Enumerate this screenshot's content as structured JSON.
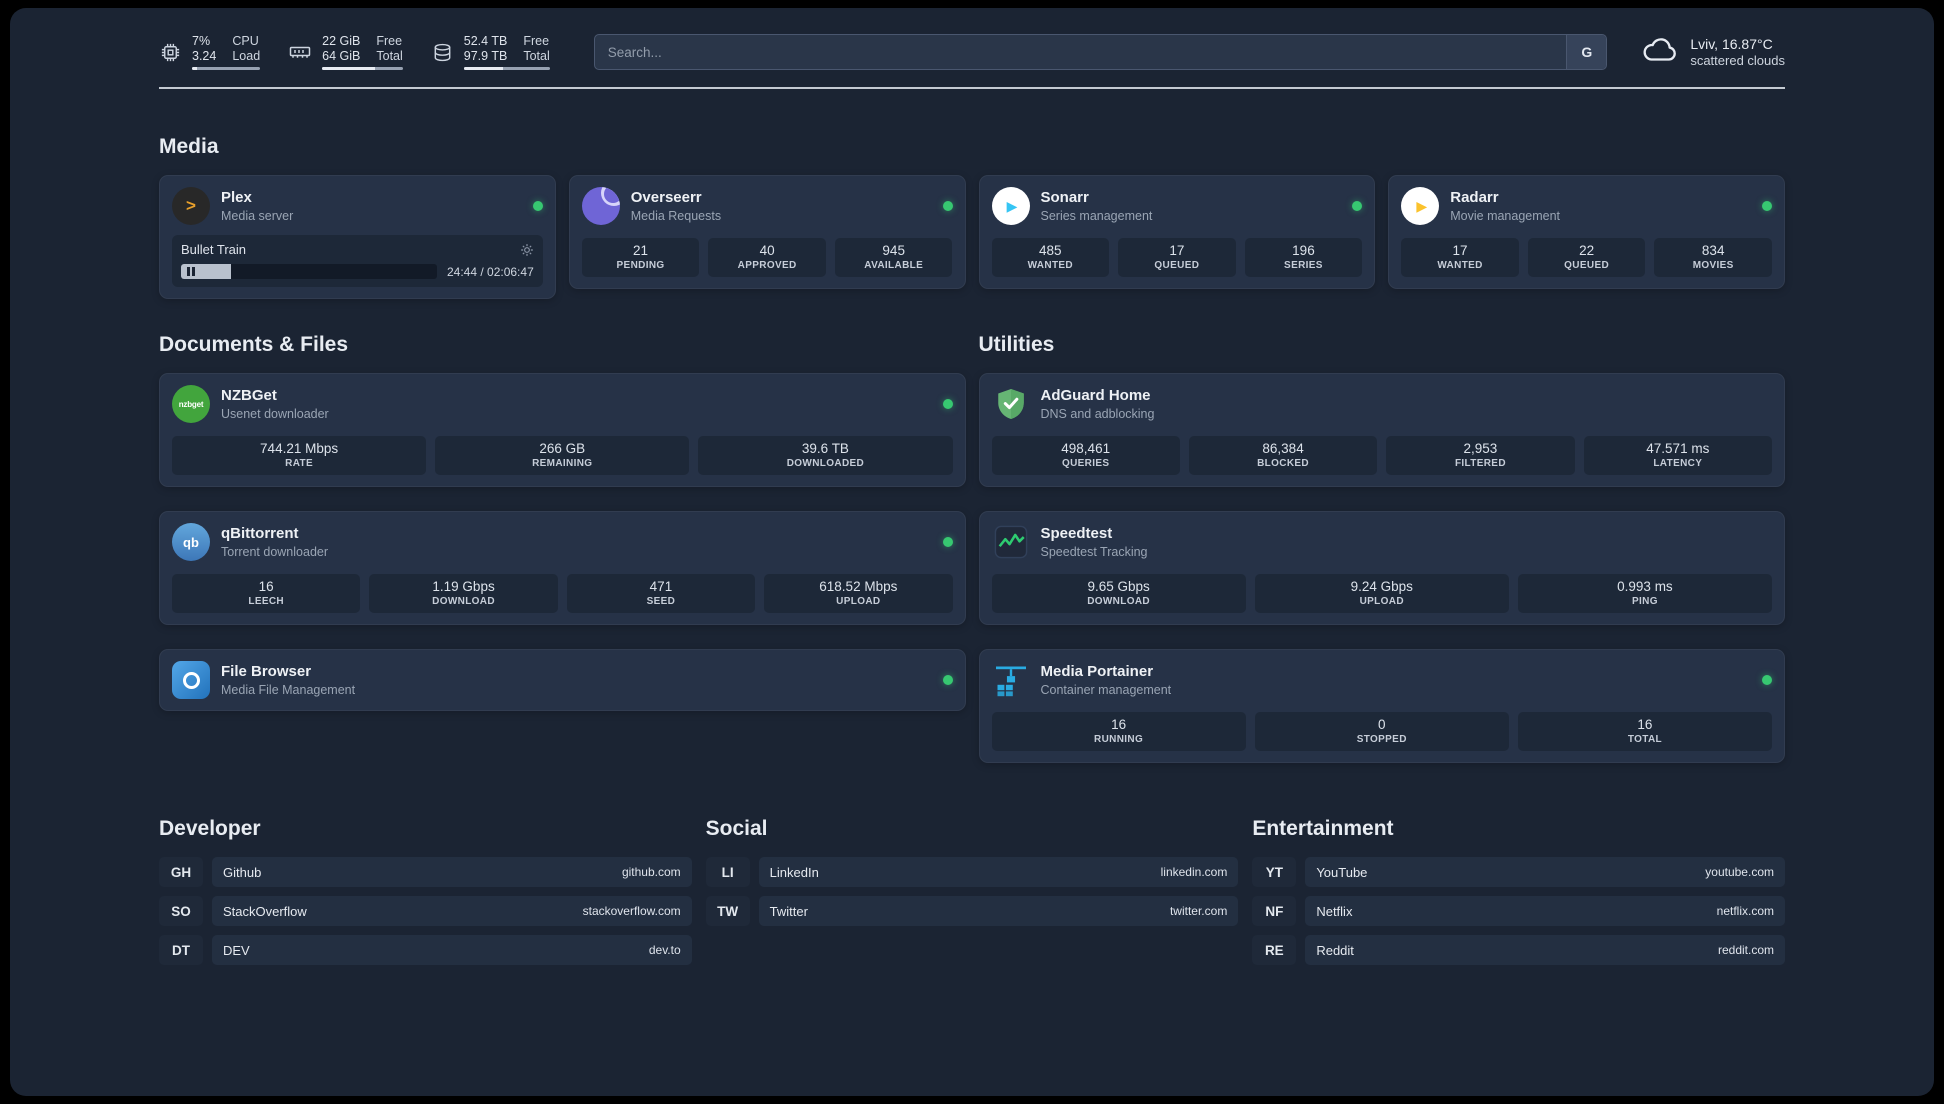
{
  "topbar": {
    "metrics": [
      {
        "value_top": "7%",
        "label_top": "CPU",
        "value_bottom": "3.24",
        "label_bottom": "Load",
        "progress_pct": 7
      },
      {
        "value_top": "22 GiB",
        "label_top": "Free",
        "value_bottom": "64 GiB",
        "label_bottom": "Total",
        "progress_pct": 66
      },
      {
        "value_top": "52.4 TB",
        "label_top": "Free",
        "value_bottom": "97.9 TB",
        "label_bottom": "Total",
        "progress_pct": 46
      }
    ],
    "search": {
      "placeholder": "Search...",
      "engine_button": "G"
    },
    "weather": {
      "location": "Lviv, 16.87°C",
      "condition": "scattered clouds"
    }
  },
  "sections": {
    "media": "Media",
    "documents": "Documents & Files",
    "utilities": "Utilities",
    "developer": "Developer",
    "social": "Social",
    "entertainment": "Entertainment"
  },
  "apps": {
    "plex": {
      "name": "Plex",
      "desc": "Media server",
      "online": true,
      "player": {
        "track": "Bullet Train",
        "time": "24:44 / 02:06:47",
        "progress_pct": 19.5
      }
    },
    "overseerr": {
      "name": "Overseerr",
      "desc": "Media Requests",
      "online": true,
      "stats": [
        {
          "value": "21",
          "label": "PENDING"
        },
        {
          "value": "40",
          "label": "APPROVED"
        },
        {
          "value": "945",
          "label": "AVAILABLE"
        }
      ]
    },
    "sonarr": {
      "name": "Sonarr",
      "desc": "Series management",
      "online": true,
      "stats": [
        {
          "value": "485",
          "label": "WANTED"
        },
        {
          "value": "17",
          "label": "QUEUED"
        },
        {
          "value": "196",
          "label": "SERIES"
        }
      ]
    },
    "radarr": {
      "name": "Radarr",
      "desc": "Movie management",
      "online": true,
      "stats": [
        {
          "value": "17",
          "label": "WANTED"
        },
        {
          "value": "22",
          "label": "QUEUED"
        },
        {
          "value": "834",
          "label": "MOVIES"
        }
      ]
    },
    "nzbget": {
      "name": "NZBGet",
      "desc": "Usenet downloader",
      "online": true,
      "stats": [
        {
          "value": "744.21 Mbps",
          "label": "RATE"
        },
        {
          "value": "266 GB",
          "label": "REMAINING"
        },
        {
          "value": "39.6 TB",
          "label": "DOWNLOADED"
        }
      ]
    },
    "qbittorrent": {
      "name": "qBittorrent",
      "desc": "Torrent downloader",
      "online": true,
      "stats": [
        {
          "value": "16",
          "label": "LEECH"
        },
        {
          "value": "1.19 Gbps",
          "label": "DOWNLOAD"
        },
        {
          "value": "471",
          "label": "SEED"
        },
        {
          "value": "618.52 Mbps",
          "label": "UPLOAD"
        }
      ]
    },
    "filebrowser": {
      "name": "File Browser",
      "desc": "Media File Management",
      "online": true
    },
    "adguard": {
      "name": "AdGuard Home",
      "desc": "DNS and adblocking",
      "online": false,
      "stats": [
        {
          "value": "498,461",
          "label": "QUERIES"
        },
        {
          "value": "86,384",
          "label": "BLOCKED"
        },
        {
          "value": "2,953",
          "label": "FILTERED"
        },
        {
          "value": "47.571 ms",
          "label": "LATENCY"
        }
      ]
    },
    "speedtest": {
      "name": "Speedtest",
      "desc": "Speedtest Tracking",
      "online": false,
      "stats": [
        {
          "value": "9.65 Gbps",
          "label": "DOWNLOAD"
        },
        {
          "value": "9.24 Gbps",
          "label": "UPLOAD"
        },
        {
          "value": "0.993 ms",
          "label": "PING"
        }
      ]
    },
    "portainer": {
      "name": "Media Portainer",
      "desc": "Container management",
      "online": true,
      "stats": [
        {
          "value": "16",
          "label": "RUNNING"
        },
        {
          "value": "0",
          "label": "STOPPED"
        },
        {
          "value": "16",
          "label": "TOTAL"
        }
      ]
    }
  },
  "icons": {
    "plex_glyph": ">",
    "sonarr_glyph": "▶",
    "radarr_glyph": "▶",
    "qbittorrent_glyph": "qb",
    "nzbget_glyph": "nzbget"
  },
  "bookmarks": {
    "developer": [
      {
        "abbr": "GH",
        "name": "Github",
        "url": "github.com"
      },
      {
        "abbr": "SO",
        "name": "StackOverflow",
        "url": "stackoverflow.com"
      },
      {
        "abbr": "DT",
        "name": "DEV",
        "url": "dev.to"
      }
    ],
    "social": [
      {
        "abbr": "LI",
        "name": "LinkedIn",
        "url": "linkedin.com"
      },
      {
        "abbr": "TW",
        "name": "Twitter",
        "url": "twitter.com"
      }
    ],
    "entertainment": [
      {
        "abbr": "YT",
        "name": "YouTube",
        "url": "youtube.com"
      },
      {
        "abbr": "NF",
        "name": "Netflix",
        "url": "netflix.com"
      },
      {
        "abbr": "RE",
        "name": "Reddit",
        "url": "reddit.com"
      }
    ]
  },
  "colors": {
    "background": "#1B2433",
    "card": "#263247",
    "tile": "#1D2838",
    "status_online": "#37C871",
    "plex_accent": "#e8a02b",
    "overseerr_purple": "#6f65d6",
    "sonarr_blue": "#35c5f4",
    "radarr_yellow": "#fbc22c",
    "nzbget_green": "#42a53d",
    "qbittorrent_blue": "#3d77b8",
    "filebrowser_blue": "#2272bb",
    "adguard_green": "#66b574",
    "speedtest_green": "#2ecc71",
    "portainer_blue": "#29abe2"
  }
}
